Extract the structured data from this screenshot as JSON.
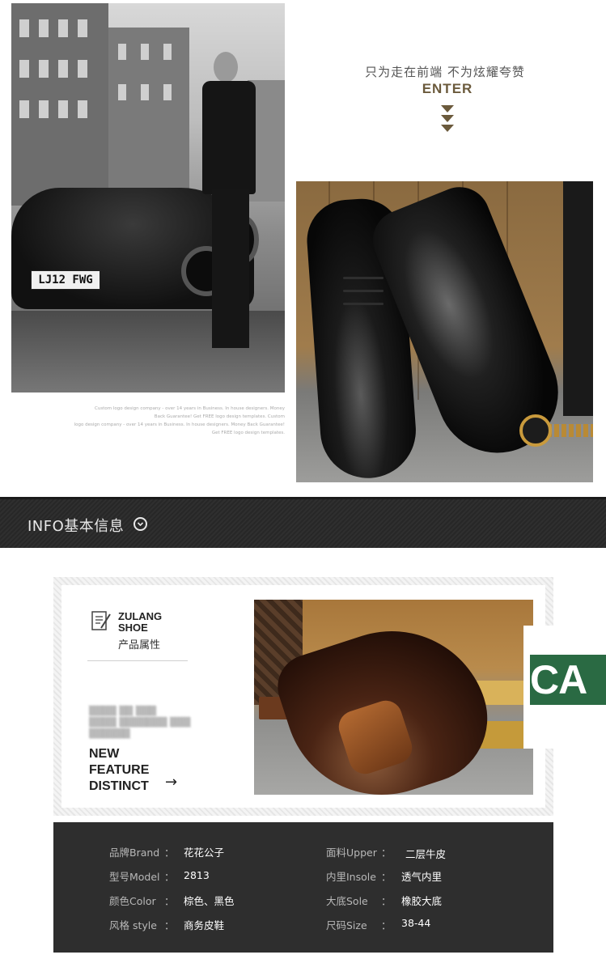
{
  "hero": {
    "plate": "LJ12 FWG"
  },
  "slogan": {
    "line1": "只为走在前端 不为炫耀夸赞",
    "line2": "ENTER"
  },
  "caption": {
    "lines": [
      "Custom logo design company - over 14 years in Business. In house designers. Money",
      "Back Guarantee! Get FREE logo design templates. Custom",
      "logo design company - over 14 years in Business. In house designers. Money Back Guarantee!",
      "Get FREE logo design templates."
    ]
  },
  "info": {
    "title": "INFO基本信息",
    "icon": "chevron-down-circle-icon"
  },
  "attributes_card": {
    "brand_line1": "ZULANG",
    "brand_line2": "SHOE",
    "brand_cn": "产品属性",
    "feature_line1": "NEW",
    "feature_line2": "FEATURE",
    "feature_line3": "DISTINCT",
    "arrow": "→"
  },
  "logo": {
    "text": "CA",
    "color": "#2a6a43"
  },
  "specs": {
    "rows": [
      {
        "label": "品牌Brand",
        "value": "花花公子",
        "label2": "面料Upper",
        "value2": "二层牛皮"
      },
      {
        "label": "型号Model",
        "value": "2813",
        "label2": "内里Insole",
        "value2": "透气内里"
      },
      {
        "label": "颜色Color",
        "value": "棕色、黑色",
        "label2": "大底Sole",
        "value2": "橡胶大底"
      },
      {
        "label": "风格 style",
        "value": "商务皮鞋",
        "label2": "尺码Size",
        "value2": "38-44"
      }
    ],
    "colon": "："
  }
}
